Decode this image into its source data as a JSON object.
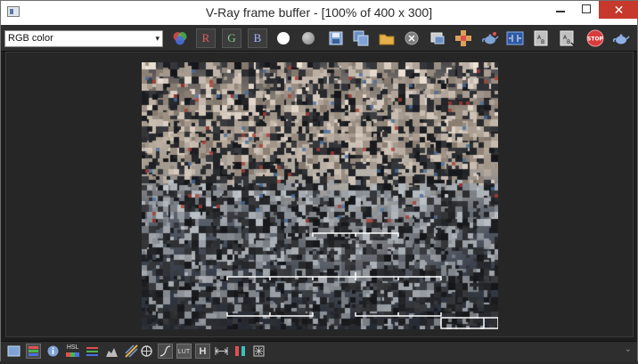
{
  "window": {
    "title": "V-Ray frame buffer - [100% of 400 x 300]",
    "minimize_icon": "minimize-icon",
    "maximize_icon": "maximize-icon",
    "close_label": "✕"
  },
  "toolbar": {
    "channel_select_value": "RGB color",
    "channel_select_arrow": "▾",
    "red_label": "R",
    "green_label": "G",
    "blue_label": "B",
    "buttons": [
      "color-channels-icon",
      "red-channel-button",
      "green-channel-button",
      "blue-channel-button",
      "alpha-channel-icon",
      "monochrome-icon",
      "save-icon",
      "save-all-icon",
      "load-icon",
      "clear-icon",
      "copy-to-max-icon",
      "track-mouse-icon",
      "render-last-icon",
      "region-render-icon",
      "link-to-vfb-icon",
      "compare-ab-icon",
      "stop-render-icon",
      "render-teapot-icon"
    ],
    "stop_label": "STOP"
  },
  "bottom_toolbar": {
    "buttons": [
      "display-correction-icon",
      "color-corrections-icon",
      "info-icon",
      "hsl-icon",
      "levels-icon",
      "histogram-icon",
      "lens-effects-icon",
      "sharpen-icon",
      "curve-icon",
      "lut-icon",
      "h-icon",
      "compare-icon",
      "history-icon",
      "stamp-icon"
    ],
    "hsl_label": "HSL",
    "lut_label": "LUT",
    "h_label": "H",
    "expand_label": "⌄"
  },
  "render": {
    "width": 400,
    "height": 300,
    "zoom": "100%",
    "status": "rendering"
  }
}
